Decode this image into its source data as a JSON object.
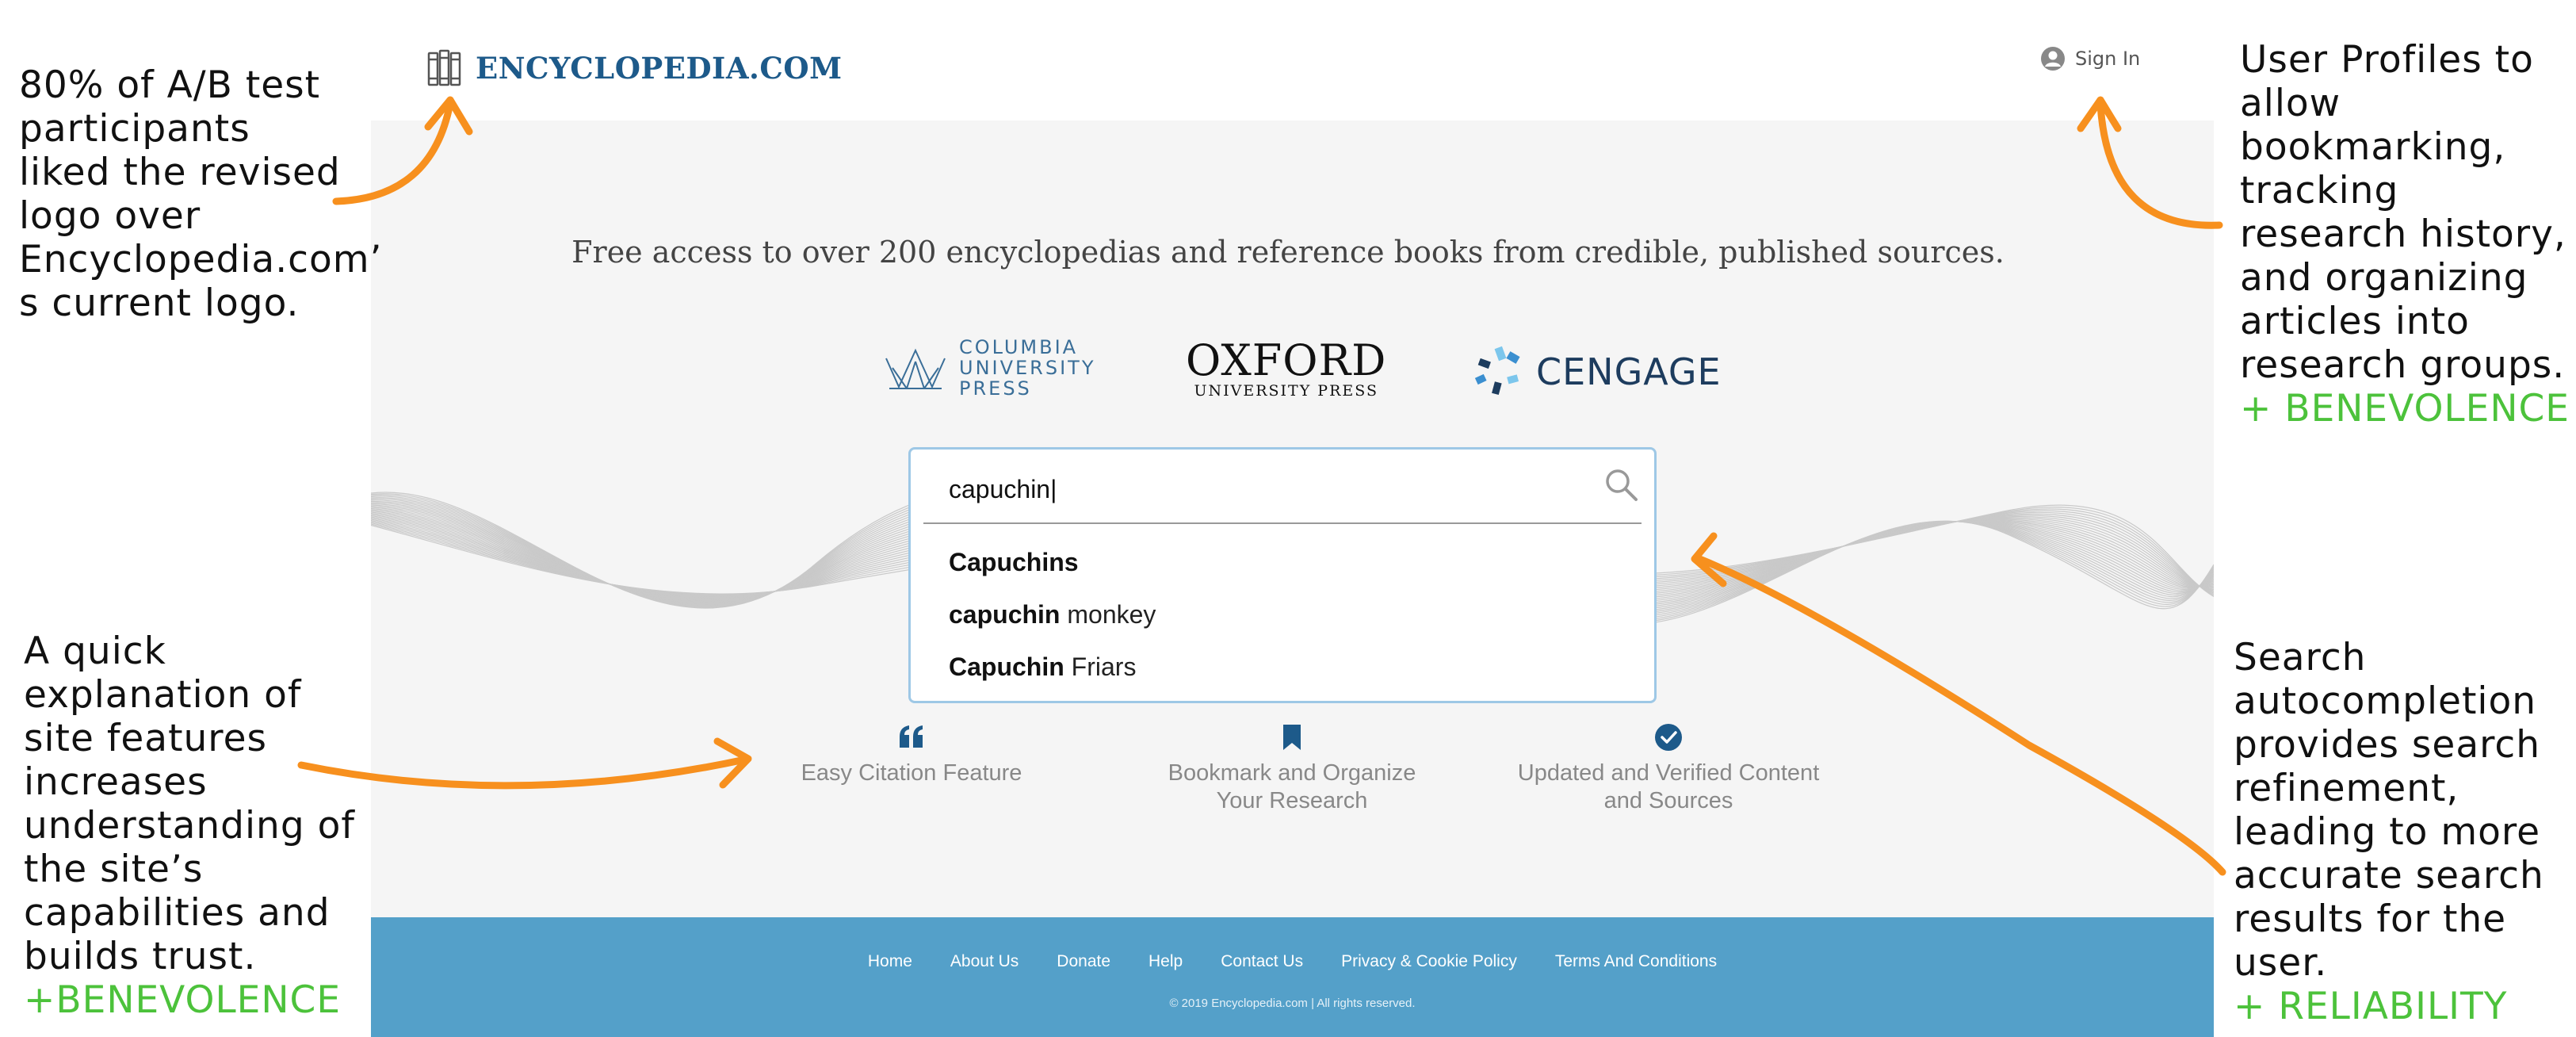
{
  "header": {
    "logo_text": "ENCYCLOPEDIA.COM",
    "sign_in": "Sign In"
  },
  "tagline": "Free access to over 200 encyclopedias and reference books from credible, published sources.",
  "publishers": {
    "columbia": [
      "COLUMBIA",
      "UNIVERSITY",
      "PRESS"
    ],
    "oxford_main": "OXFORD",
    "oxford_sub": "UNIVERSITY PRESS",
    "cengage": "CENGAGE"
  },
  "search": {
    "value": "capuchin|",
    "suggestions": [
      {
        "bold": "Capuchins",
        "rest": ""
      },
      {
        "bold": "capuchin",
        "rest": " monkey"
      },
      {
        "bold": "Capuchin",
        "rest": " Friars"
      }
    ]
  },
  "features": [
    {
      "icon": "quote-icon",
      "lines": [
        "Easy Citation Feature"
      ]
    },
    {
      "icon": "bookmark-icon",
      "lines": [
        "Bookmark and Organize",
        "Your Research"
      ]
    },
    {
      "icon": "check-circle-icon",
      "lines": [
        "Updated and Verified Content",
        "and Sources"
      ]
    }
  ],
  "footer": {
    "links": [
      "Home",
      "About Us",
      "Donate",
      "Help",
      "Contact Us",
      "Privacy & Cookie Policy",
      "Terms And Conditions"
    ],
    "copyright": "© 2019 Encyclopedia.com | All rights reserved."
  },
  "annotations": {
    "logo": {
      "lines": [
        "80% of A/B test",
        "participants",
        "liked the revised",
        "logo over",
        "Encyclopedia.com’",
        "s current logo."
      ],
      "tag": ""
    },
    "features": {
      "lines": [
        "A quick",
        "explanation of",
        "site features",
        "increases",
        "understanding of",
        "the site’s",
        "capabilities and",
        "builds trust."
      ],
      "tag": "+BENEVOLENCE"
    },
    "profiles": {
      "lines": [
        "User Profiles to",
        "allow",
        "bookmarking,",
        "tracking",
        "research history,",
        "and organizing",
        "articles into",
        "research groups."
      ],
      "tag": "+ BENEVOLENCE"
    },
    "search": {
      "lines": [
        "Search",
        "autocompletion",
        "provides search",
        "refinement,",
        "leading to more",
        "accurate search",
        "results for the",
        "user."
      ],
      "tag": "+ RELIABILITY"
    }
  },
  "colors": {
    "brand": "#1d5a8a",
    "arrow": "#f7901e",
    "tag_green": "#4cc23b",
    "footer": "#54a0c9",
    "search_border": "#9ec8e6"
  }
}
